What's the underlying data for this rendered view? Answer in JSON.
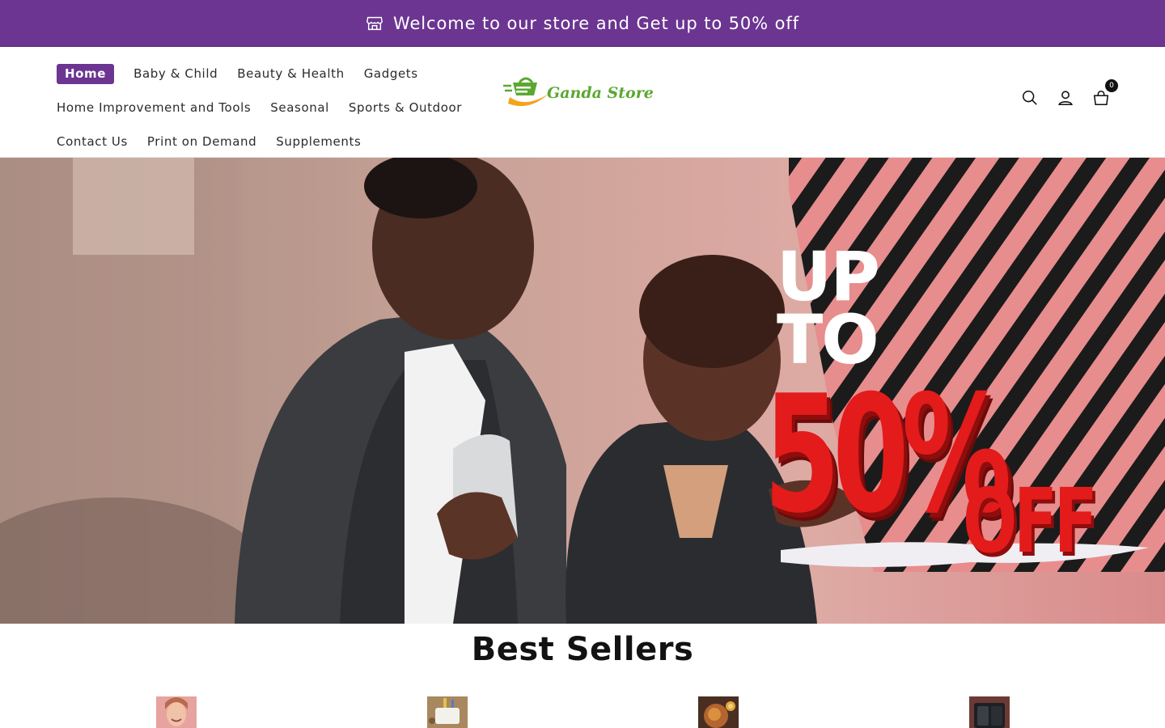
{
  "announcement": {
    "text": "Welcome to our store and Get up to 50% off",
    "icon": "store-icon"
  },
  "nav": {
    "rows": [
      [
        "Home",
        "Baby & Child",
        "Beauty & Health",
        "Gadgets"
      ],
      [
        "Home Improvement and Tools",
        "Seasonal",
        "Sports & Outdoor"
      ],
      [
        "Contact Us",
        "Print on Demand",
        "Supplements"
      ]
    ],
    "active": "Home"
  },
  "logo": {
    "text": "Ganda Store"
  },
  "header_icons": {
    "search": "search-icon",
    "account": "user-icon",
    "cart": "cart-icon",
    "cart_count": "0"
  },
  "hero": {
    "promo_line1": "UP",
    "promo_line2": "TO",
    "promo_big": "50%",
    "promo_off": "OFF"
  },
  "best_sellers": {
    "title": "Best Sellers",
    "products": [
      {
        "thumb": "woman-face-thumb"
      },
      {
        "thumb": "packaging-thumb"
      },
      {
        "thumb": "food-plate-thumb"
      },
      {
        "thumb": "phone-case-thumb"
      }
    ]
  },
  "colors": {
    "brand_purple": "#6b3591",
    "logo_green": "#5aa832",
    "logo_orange": "#f2a51a",
    "promo_red": "#e31b1b"
  }
}
